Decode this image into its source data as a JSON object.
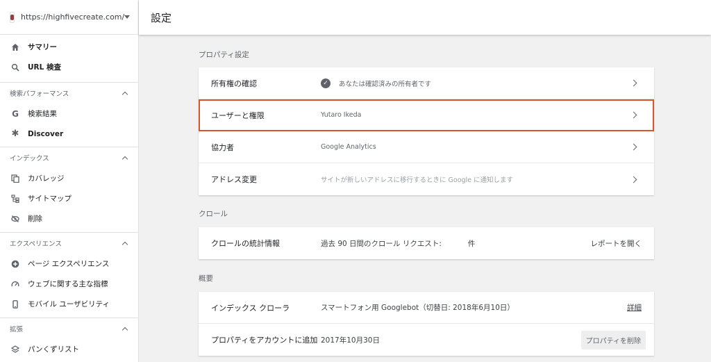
{
  "sidebar": {
    "property_url": "https://highfivecreate.com/",
    "top_items": [
      {
        "label": "サマリー"
      },
      {
        "label": "URL 検査"
      }
    ],
    "sections": [
      {
        "title": "検索パフォーマンス",
        "items": [
          {
            "label": "検索結果"
          },
          {
            "label": "Discover"
          }
        ]
      },
      {
        "title": "インデックス",
        "items": [
          {
            "label": "カバレッジ"
          },
          {
            "label": "サイトマップ"
          },
          {
            "label": "削除"
          }
        ]
      },
      {
        "title": "エクスペリエンス",
        "items": [
          {
            "label": "ページ エクスペリエンス"
          },
          {
            "label": "ウェブに関する主な指標"
          },
          {
            "label": "モバイル ユーザビリティ"
          }
        ]
      },
      {
        "title": "拡張",
        "items": [
          {
            "label": "パンくずリスト"
          }
        ]
      }
    ]
  },
  "header": {
    "title": "設定"
  },
  "property_settings": {
    "title": "プロパティ設定",
    "rows": [
      {
        "label": "所有権の確認",
        "value": "あなたは確認済みの所有者です"
      },
      {
        "label": "ユーザーと権限",
        "value": "Yutaro Ikeda"
      },
      {
        "label": "協力者",
        "value": "Google Analytics"
      },
      {
        "label": "アドレス変更",
        "value": "サイトが新しいアドレスに移行するときに Google に通知します"
      }
    ]
  },
  "crawl": {
    "title": "クロール",
    "row": {
      "label": "クロールの統計情報",
      "value_prefix": "過去 90 日間のクロール リクエスト:",
      "value_suffix": "件",
      "action": "レポートを開く"
    }
  },
  "overview": {
    "title": "概要",
    "rows": [
      {
        "label": "インデックス クローラ",
        "value": "スマートフォン用 Googlebot（切替日: 2018年6月10日）",
        "action": "詳細"
      },
      {
        "label": "プロパティをアカウントに追加",
        "value": "2017年10月30日",
        "action": "プロパティを削除"
      }
    ]
  }
}
